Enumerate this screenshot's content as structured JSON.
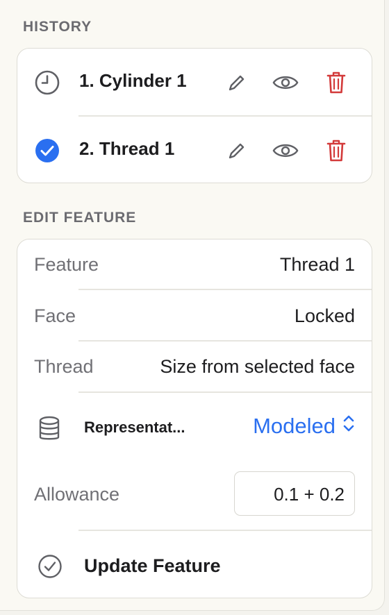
{
  "history": {
    "title": "HISTORY",
    "items": [
      {
        "label": "1. Cylinder 1",
        "status_icon": "clock-icon"
      },
      {
        "label": "2. Thread 1",
        "status_icon": "check-circle-icon"
      }
    ]
  },
  "edit_feature": {
    "title": "EDIT FEATURE",
    "feature": {
      "label": "Feature",
      "value": "Thread 1"
    },
    "face": {
      "label": "Face",
      "value": "Locked"
    },
    "thread": {
      "label": "Thread",
      "value": "Size from selected face"
    },
    "representation": {
      "label": "Representat...",
      "value": "Modeled"
    },
    "allowance": {
      "label": "Allowance",
      "value": "0.1 + 0.2"
    },
    "update_label": "Update Feature"
  },
  "colors": {
    "accent": "#2a6ff0",
    "delete": "#d33a3a",
    "icon": "#5f6065"
  }
}
